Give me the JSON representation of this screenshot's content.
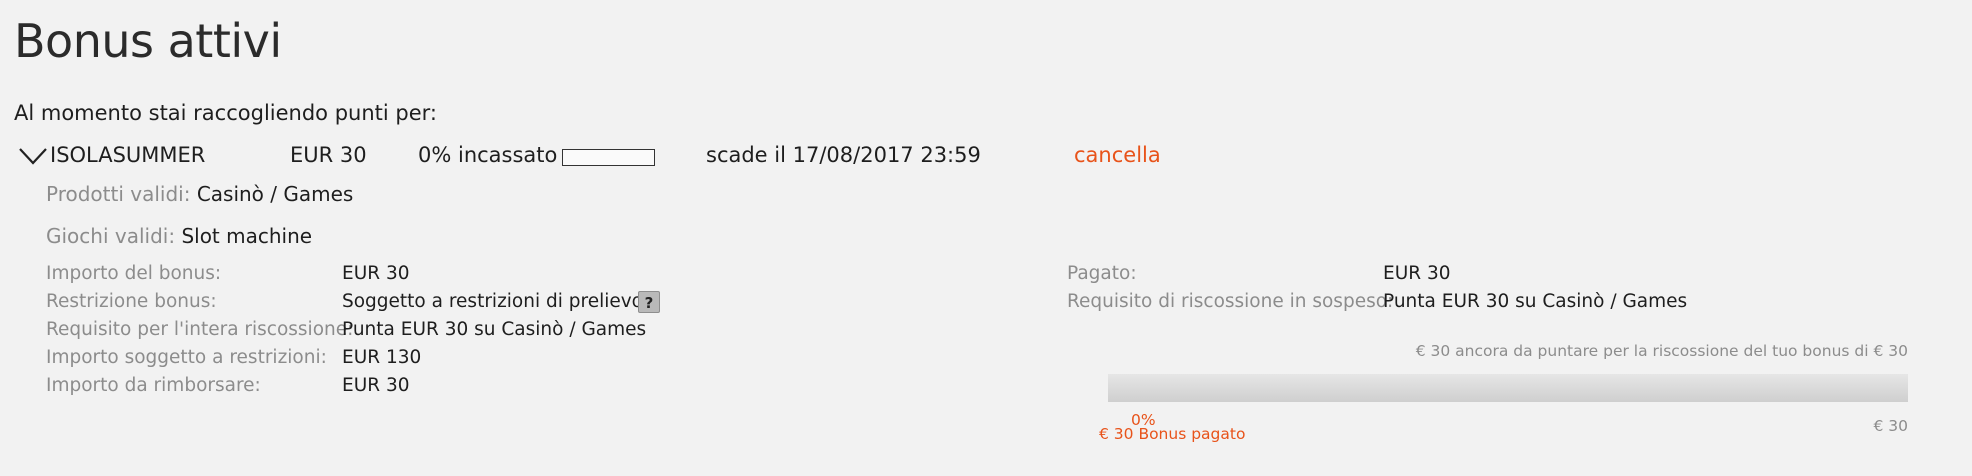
{
  "page": {
    "title": "Bonus attivi",
    "intro": "Al momento stai raccogliendo punti per:"
  },
  "bonus": {
    "name": "ISOLASUMMER",
    "amount": "EUR 30",
    "cashed": "0% incassato",
    "cashed_fraction": 0,
    "expires": "scade il 17/08/2017 23:59",
    "cancel_label": "cancella",
    "products_label": "Prodotti validi:",
    "products_value": "Casinò / Games",
    "games_label": "Giochi validi:",
    "games_value": "Slot machine"
  },
  "details_left": [
    {
      "label": "Importo del bonus:",
      "value": "EUR 30"
    },
    {
      "label": "Restrizione bonus:",
      "value": "Soggetto a restrizioni di prelievo"
    },
    {
      "label": "Requisito per l'intera riscossione:",
      "value": "Punta EUR 30 su Casinò / Games"
    },
    {
      "label": "Importo soggetto a restrizioni:",
      "value": "EUR 130"
    },
    {
      "label": "Importo da rimborsare:",
      "value": "EUR 30"
    }
  ],
  "help_label": "?",
  "details_right": [
    {
      "label": "Pagato:",
      "value": "EUR 30"
    },
    {
      "label": "Requisito di riscossione in sospeso:",
      "value": "Punta EUR 30 su Casinò / Games"
    }
  ],
  "wager": {
    "note": "€ 30 ancora da puntare per la riscossione del tuo bonus di € 30",
    "percent_label": "0%",
    "progress_fraction": 0,
    "paid_label": "€ 30 Bonus pagato",
    "max_label": "€ 30"
  },
  "colors": {
    "accent": "#e8531a",
    "label_grey": "#8c8c8c",
    "background": "#f2f2f2"
  }
}
